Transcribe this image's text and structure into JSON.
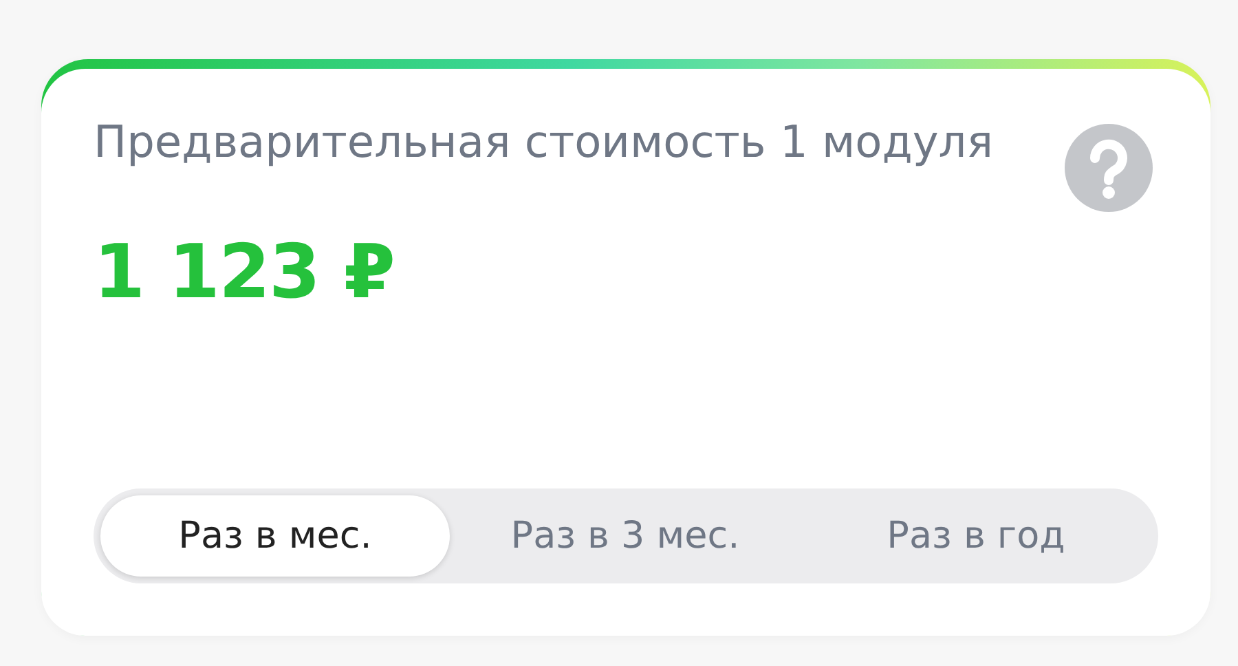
{
  "card": {
    "title": "Предварительная стоимость 1 модуля",
    "price": "1 123 ₽",
    "periods": [
      {
        "label": "Раз в мес.",
        "selected": true
      },
      {
        "label": "Раз в 3 мес.",
        "selected": false
      },
      {
        "label": "Раз в год",
        "selected": false
      }
    ]
  }
}
